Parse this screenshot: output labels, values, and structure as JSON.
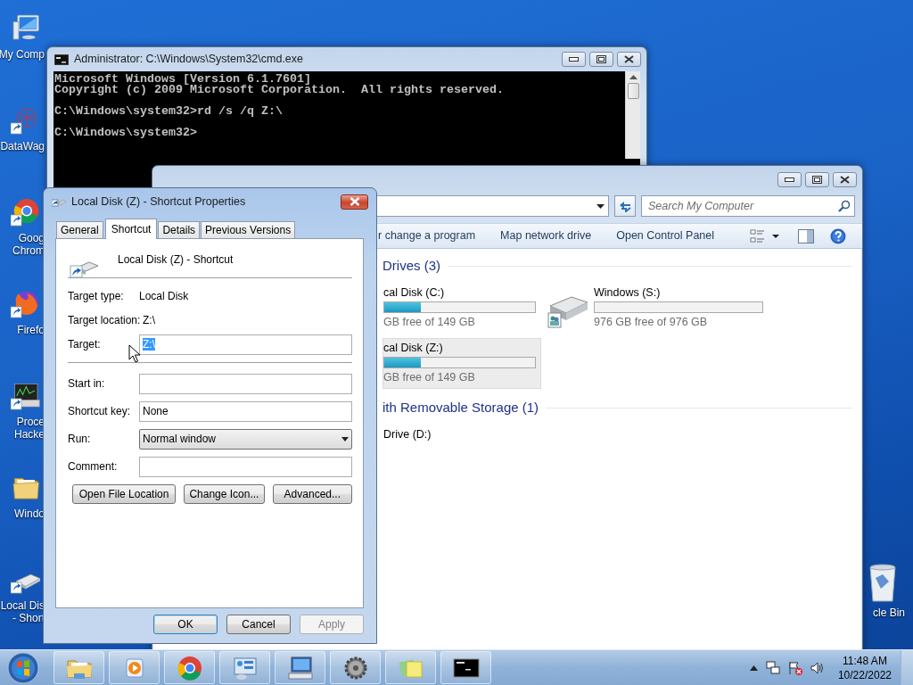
{
  "desktop_icons": [
    {
      "kind": "computer",
      "shortcut": false,
      "lines": [
        "My Comp"
      ]
    },
    {
      "kind": "network",
      "shortcut": true,
      "lines": [
        "DataWag"
      ]
    },
    {
      "kind": "chrome",
      "shortcut": true,
      "lines": [
        "Goog",
        "Chrom"
      ]
    },
    {
      "kind": "firefox",
      "shortcut": true,
      "lines": [
        "Firefo"
      ]
    },
    {
      "kind": "monitor",
      "shortcut": true,
      "lines": [
        "Proce",
        "Hacke"
      ]
    },
    {
      "kind": "folder",
      "shortcut": false,
      "lines": [
        "Windo"
      ]
    },
    {
      "kind": "drive",
      "shortcut": true,
      "lines": [
        "Local Dis",
        "- Short"
      ]
    }
  ],
  "recycle_bin": {
    "label": "cle Bin"
  },
  "cmd_window": {
    "title": "Administrator: C:\\Windows\\System32\\cmd.exe",
    "blocks": [
      [
        "Microsoft Windows [Version 6.1.7601]",
        "Copyright (c) 2009 Microsoft Corporation.  All rights reserved."
      ],
      [
        "C:\\Windows\\system32>rd /s /q Z:\\"
      ],
      [
        "C:\\Windows\\system32>"
      ]
    ]
  },
  "explorer_window": {
    "search": {
      "placeholder": "Search My Computer"
    },
    "toolbar": [
      "r change a program",
      "Map network drive",
      "Open Control Panel"
    ],
    "groups": [
      {
        "title": "Drives (3)",
        "items": [
          {
            "kind": "cut",
            "name": "cal Disk (C:)",
            "free": "GB free of 149 GB",
            "level": 0.24,
            "selected": false
          },
          {
            "kind": "shared_disk",
            "name": "Windows (S:)",
            "free": "976 GB free of 976 GB",
            "level": 0,
            "selected": false
          },
          {
            "kind": "cut",
            "name": "cal Disk (Z:)",
            "free": "GB free of 149 GB",
            "level": 0.24,
            "selected": true
          }
        ]
      },
      {
        "title": "ith Removable Storage (1)",
        "items": [
          {
            "kind": "cut",
            "name": "Drive (D:)",
            "selected": false
          }
        ]
      }
    ]
  },
  "properties_dialog": {
    "title": "Local Disk (Z) - Shortcut Properties",
    "tabs": [
      {
        "label": "General",
        "selected": false
      },
      {
        "label": "Shortcut",
        "selected": true
      },
      {
        "label": "Details",
        "selected": false
      },
      {
        "label": "Previous Versions",
        "selected": false
      }
    ],
    "shortcut_name": "Local Disk (Z) - Shortcut",
    "info": [
      {
        "label": "Target type:",
        "value": "Local Disk"
      },
      {
        "label": "Target location:",
        "value": "Z:\\"
      }
    ],
    "target_field": {
      "label": "Target:",
      "value": "Z:\\",
      "text_selected": true
    },
    "fields": [
      {
        "kind": "text",
        "label": "Start in:"
      },
      {
        "kind": "text",
        "label": "Shortcut key:",
        "value": "None"
      },
      {
        "kind": "dropdown",
        "label": "Run:",
        "value": "Normal window"
      },
      {
        "kind": "text",
        "label": "Comment:"
      }
    ],
    "actions": [
      "Open File Location",
      "Change Icon...",
      "Advanced..."
    ],
    "buttons": [
      {
        "label": "OK",
        "default": true,
        "disabled": false
      },
      {
        "label": "Cancel",
        "default": false,
        "disabled": false
      },
      {
        "label": "Apply",
        "default": false,
        "disabled": true
      }
    ]
  },
  "taskbar": {
    "buttons": [
      {
        "kind": "explorer"
      },
      {
        "kind": "media"
      },
      {
        "kind": "chrome"
      },
      {
        "kind": "panel"
      },
      {
        "kind": "remote"
      },
      {
        "kind": "gear"
      },
      {
        "kind": "notes"
      },
      {
        "kind": "console"
      }
    ],
    "time": "11:48 AM",
    "date": "10/22/2022"
  }
}
